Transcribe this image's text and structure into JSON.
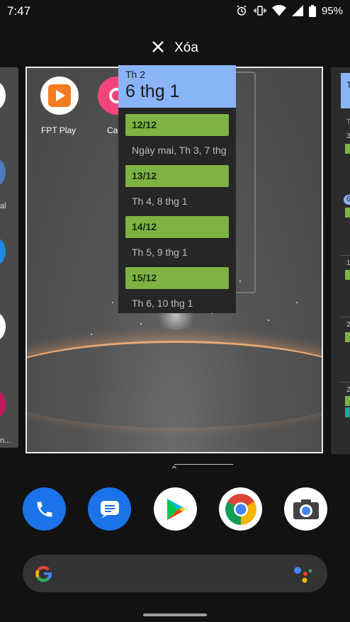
{
  "status_bar": {
    "time": "7:47",
    "battery": "95%",
    "icons": [
      "alarm-icon",
      "vibrate-icon",
      "wifi-icon",
      "signal-icon",
      "battery-icon"
    ]
  },
  "recents": {
    "clear_label": "Xóa"
  },
  "left_card": {
    "labels": [
      "al",
      "n..."
    ]
  },
  "main_card": {
    "apps": [
      {
        "name": "FPT Play",
        "icon": "fpt-play-icon"
      },
      {
        "name": "Cal",
        "icon": "calendar-app-icon"
      }
    ]
  },
  "calendar_widget": {
    "day_of_week": "Th 2",
    "date": "6 thg 1",
    "events": [
      {
        "title": "12/12",
        "subtitle": "Ngày mai, Th 3, 7 thg"
      },
      {
        "title": "13/12",
        "subtitle": "Th 4, 8 thg 1"
      },
      {
        "title": "14/12",
        "subtitle": "Th 5, 9 thg 1"
      },
      {
        "title": "15/12",
        "subtitle": "Th 6, 10 thg 1"
      }
    ],
    "accent_color": "#8ab4f8",
    "event_color": "#7cb342"
  },
  "right_card": {
    "peek_letters": [
      "T",
      "T",
      "3",
      "6",
      "1",
      "2",
      "2"
    ]
  },
  "dock": {
    "apps": [
      "phone-icon",
      "messages-icon",
      "play-store-icon",
      "chrome-icon",
      "camera-icon"
    ]
  },
  "search": {
    "icons": [
      "google-g-icon",
      "assistant-icon"
    ]
  }
}
